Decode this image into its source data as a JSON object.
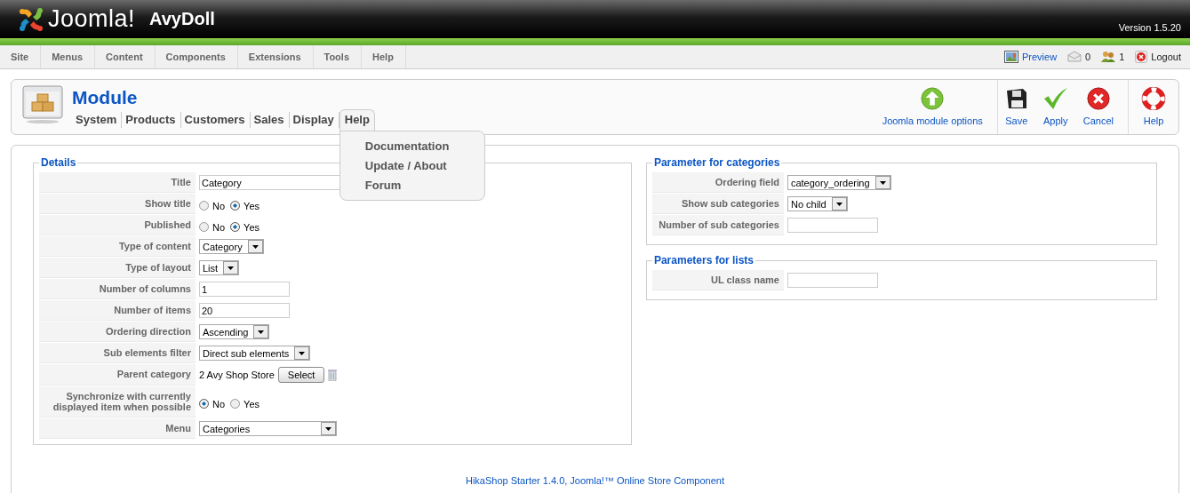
{
  "header": {
    "logo_text": "Joomla!",
    "site_name": "AvyDoll",
    "version": "Version 1.5.20"
  },
  "menu": [
    "Site",
    "Menus",
    "Content",
    "Components",
    "Extensions",
    "Tools",
    "Help"
  ],
  "status": [
    {
      "kind": "preview",
      "label": "Preview"
    },
    {
      "kind": "messages",
      "label": "0"
    },
    {
      "kind": "users",
      "label": "1"
    },
    {
      "kind": "logout",
      "label": "Logout"
    }
  ],
  "toolbar": {
    "title": "Module",
    "subnav": [
      {
        "label": "System",
        "selected": false
      },
      {
        "label": "Products",
        "selected": false
      },
      {
        "label": "Customers",
        "selected": false
      },
      {
        "label": "Sales",
        "selected": false
      },
      {
        "label": "Display",
        "selected": false
      },
      {
        "label": "Help",
        "selected": true,
        "expanded": true,
        "children": [
          "Documentation",
          "Update / About",
          "Forum"
        ]
      }
    ],
    "actions": [
      {
        "kind": "options",
        "label": "Joomla module options"
      },
      {
        "kind": "save",
        "label": "Save"
      },
      {
        "kind": "apply",
        "label": "Apply"
      },
      {
        "kind": "cancel",
        "label": "Cancel"
      },
      {
        "kind": "help",
        "label": "Help"
      }
    ]
  },
  "details": {
    "legend": "Details",
    "fields": [
      {
        "kind": "text",
        "label": "Title",
        "value": "Category"
      },
      {
        "kind": "radio",
        "label": "Show title",
        "options": [
          {
            "label": "No",
            "selected": false
          },
          {
            "label": "Yes",
            "selected": true
          }
        ]
      },
      {
        "kind": "radio",
        "label": "Published",
        "options": [
          {
            "label": "No",
            "selected": false
          },
          {
            "label": "Yes",
            "selected": true
          }
        ]
      },
      {
        "kind": "select",
        "label": "Type of content",
        "value": "Category"
      },
      {
        "kind": "select",
        "label": "Type of layout",
        "value": "List"
      },
      {
        "kind": "text",
        "label": "Number of columns",
        "value": "1"
      },
      {
        "kind": "text",
        "label": "Number of items",
        "value": "20"
      },
      {
        "kind": "select",
        "label": "Ordering direction",
        "value": "Ascending"
      },
      {
        "kind": "select",
        "label": "Sub elements filter",
        "value": "Direct sub elements"
      },
      {
        "kind": "picker",
        "label": "Parent category",
        "value": "2 Avy Shop Store",
        "button": "Select"
      },
      {
        "kind": "radio",
        "label": "Synchronize with currently displayed item when possible",
        "options": [
          {
            "label": "No",
            "selected": true
          },
          {
            "label": "Yes",
            "selected": false
          }
        ]
      },
      {
        "kind": "select",
        "label": "Menu",
        "value": "Categories"
      }
    ]
  },
  "categories": {
    "legend": "Parameter for categories",
    "fields": [
      {
        "kind": "select",
        "label": "Ordering field",
        "value": "category_ordering"
      },
      {
        "kind": "select",
        "label": "Show sub categories",
        "value": "No child"
      },
      {
        "kind": "text",
        "label": "Number of sub categories"
      }
    ]
  },
  "lists": {
    "legend": "Parameters for lists",
    "fields": [
      {
        "kind": "text",
        "label": "UL class name"
      }
    ]
  },
  "footer": "HikaShop Starter 1.4.0, Joomla!™ Online Store Component"
}
